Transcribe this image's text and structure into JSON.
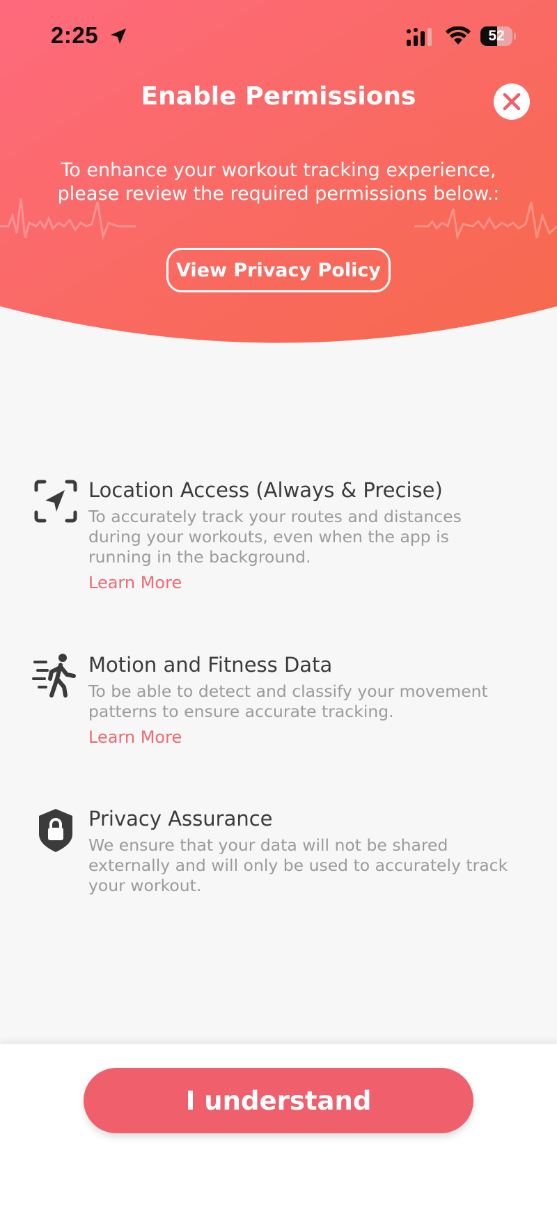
{
  "status_bar": {
    "time": "2:25",
    "battery": "52",
    "battery_level": 0.52
  },
  "header": {
    "title": "Enable Permissions",
    "subtitle": "To enhance your workout tracking experience, please review the required permissions below.:",
    "privacy_button": "View Privacy Policy",
    "close_icon": "close-icon"
  },
  "permissions": [
    {
      "icon": "location-icon",
      "title": "Location Access (Always & Precise)",
      "description": "To accurately track your routes and distances during your workouts, even when the app is running in the background.",
      "link": "Learn More"
    },
    {
      "icon": "walking-motion-icon",
      "title": "Motion and Fitness Data",
      "description": "To be able to detect and classify your movement patterns to ensure accurate tracking.",
      "link": "Learn More"
    },
    {
      "icon": "shield-lock-icon",
      "title": "Privacy Assurance",
      "description": "We ensure that your data will not be shared externally and will only be used to accurately track your workout."
    }
  ],
  "footer": {
    "button": "I understand"
  },
  "colors": {
    "gradient_start": "#fe6a7d",
    "gradient_end": "#f6694c",
    "accent": "#ec6b71",
    "button": "#ef5f6c",
    "background": "#f7f7f7"
  }
}
